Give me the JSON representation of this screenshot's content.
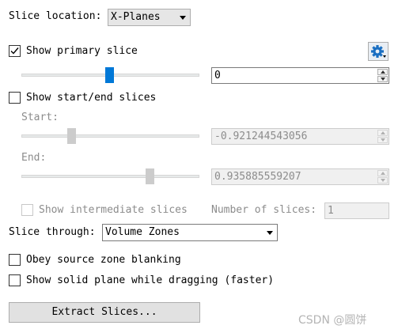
{
  "slice_location": {
    "label": "Slice location:",
    "value": "X-Planes"
  },
  "primary_slice": {
    "label": "Show primary slice",
    "checked": true,
    "value": "0",
    "slider_fraction": 0.5
  },
  "start_end": {
    "label": "Show start/end slices",
    "checked": false,
    "start_label": "Start:",
    "start_value": "-0.921244543056",
    "start_fraction": 0.27,
    "end_label": "End:",
    "end_value": "0.935885559207",
    "end_fraction": 0.73
  },
  "intermediate": {
    "label": "Show intermediate slices",
    "checked": false,
    "count_label": "Number of slices:",
    "count_value": "1"
  },
  "slice_through": {
    "label": "Slice through:",
    "value": "Volume Zones"
  },
  "obey_blanking": {
    "label": "Obey source zone blanking",
    "checked": false
  },
  "solid_plane": {
    "label": "Show solid plane while dragging (faster)",
    "checked": false
  },
  "extract_button": {
    "label": "Extract Slices..."
  },
  "watermark": "CSDN @圆饼",
  "icons": {
    "settings": "gear-icon",
    "check": "check-icon"
  },
  "colors": {
    "accent": "#0078d7",
    "gear": "#1b6fc2"
  }
}
